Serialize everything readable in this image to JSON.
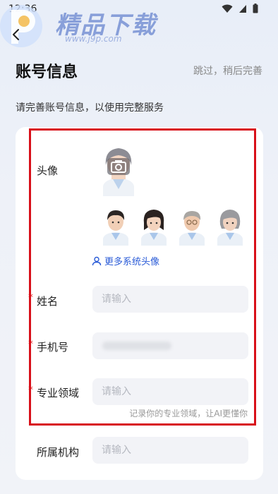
{
  "status_bar": {
    "time": "12:36"
  },
  "watermark": {
    "brand": "精品下载",
    "url": "www.j9p.com"
  },
  "header": {
    "title": "账号信息",
    "skip_label": "跳过，稍后完善",
    "subtitle": "请完善账号信息，以使用完整服务"
  },
  "form": {
    "avatar_label": "头像",
    "more_avatars_label": "更多系统头像",
    "name_label": "姓名",
    "name_placeholder": "请输入",
    "phone_label": "手机号",
    "phone_placeholder": "",
    "specialty_label": "专业领域",
    "specialty_placeholder": "请输入",
    "specialty_hint": "记录你的专业领域，让AI更懂你",
    "institution_label": "所属机构",
    "institution_placeholder": "请输入",
    "required_mark": "*"
  },
  "colors": {
    "accent": "#2a5bd7",
    "required": "#e02020",
    "highlight": "#d8101a"
  }
}
